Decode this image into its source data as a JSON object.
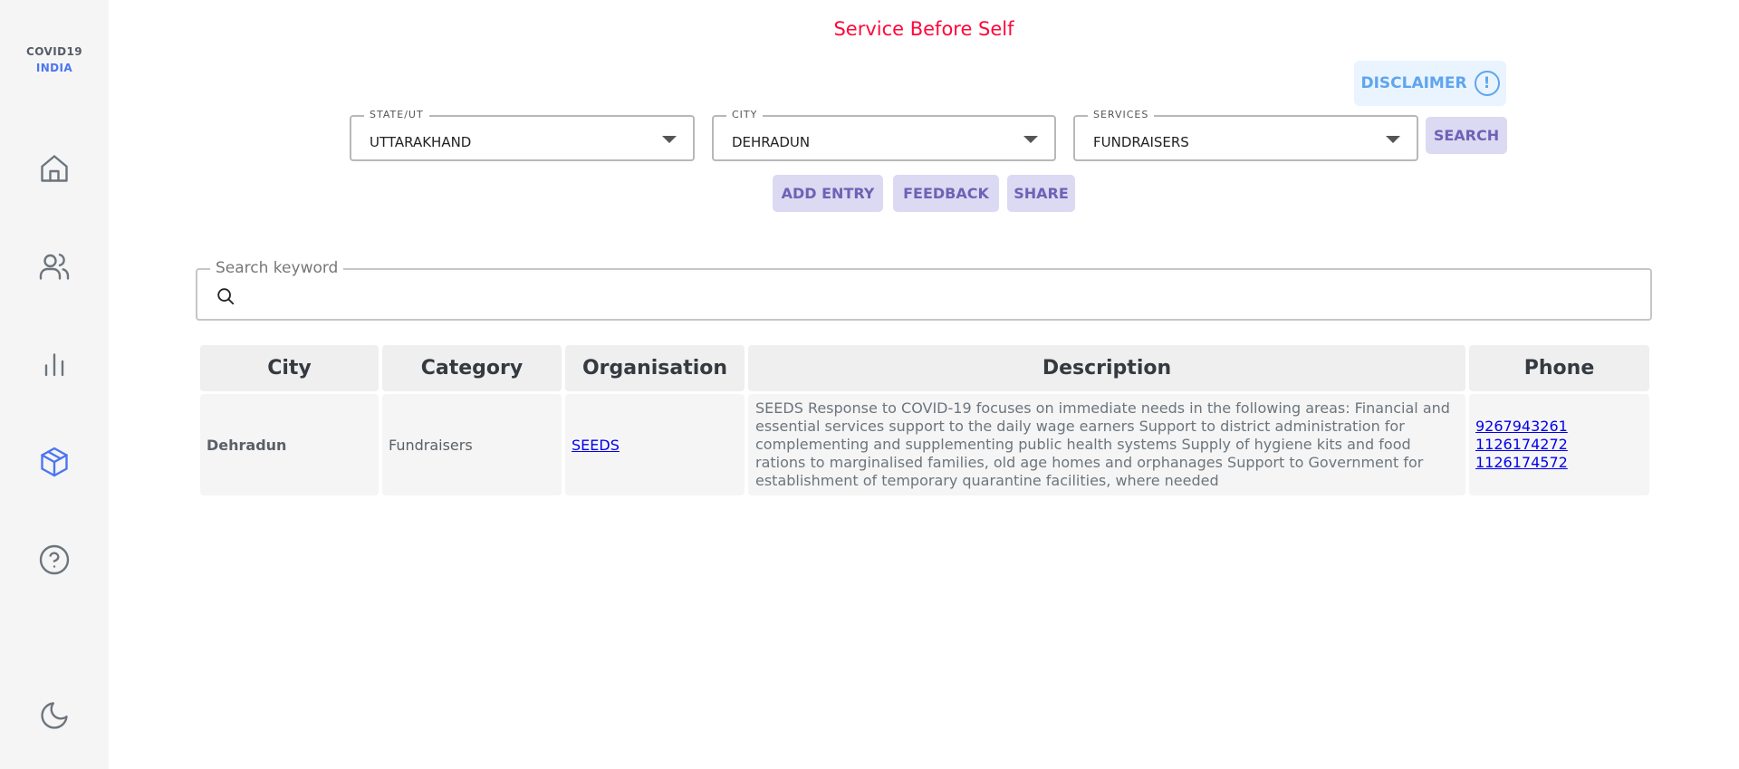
{
  "logo": {
    "line1": "COVID19",
    "line2": "INDIA"
  },
  "nav": [
    {
      "name": "home",
      "icon": "home-icon"
    },
    {
      "name": "volunteers",
      "icon": "users-icon"
    },
    {
      "name": "stats",
      "icon": "bar-chart-icon"
    },
    {
      "name": "resources",
      "icon": "box-icon",
      "active": true
    },
    {
      "name": "help",
      "icon": "help-icon"
    },
    {
      "name": "theme",
      "icon": "moon-icon"
    }
  ],
  "header": {
    "tagline": "Service Before Self",
    "disclaimer_label": "DISCLAIMER"
  },
  "filters": {
    "state": {
      "label": "STATE/UT",
      "value": "UTTARAKHAND"
    },
    "city": {
      "label": "CITY",
      "value": "DEHRADUN"
    },
    "services": {
      "label": "SERVICES",
      "value": "FUNDRAISERS"
    },
    "search_label": "SEARCH"
  },
  "actions": {
    "add_entry": "ADD ENTRY",
    "feedback": "FEEDBACK",
    "share": "SHARE"
  },
  "search": {
    "label": "Search keyword",
    "value": ""
  },
  "table": {
    "headers": {
      "city": "City",
      "category": "Category",
      "organisation": "Organisation",
      "description": "Description",
      "phone": "Phone"
    },
    "rows": [
      {
        "city": "Dehradun",
        "category": "Fundraisers",
        "organisation": "SEEDS",
        "description": "SEEDS Response to COVID-19 focuses on immediate needs in the following areas: Financial and essential services support to the daily wage earners Support to district administration for complementing and supplementing public health systems Supply of hygiene kits and food rations to marginalised families, old age homes and orphanages Support to Government for establishment of temporary quarantine facilities, where needed",
        "phones": [
          "9267943261",
          "1126174272",
          "1126174572"
        ]
      }
    ]
  },
  "colors": {
    "accent": "#4c75f2",
    "tagline": "#ff073a",
    "button_bg": "#dcd9f2",
    "button_text": "#6c63b6"
  }
}
